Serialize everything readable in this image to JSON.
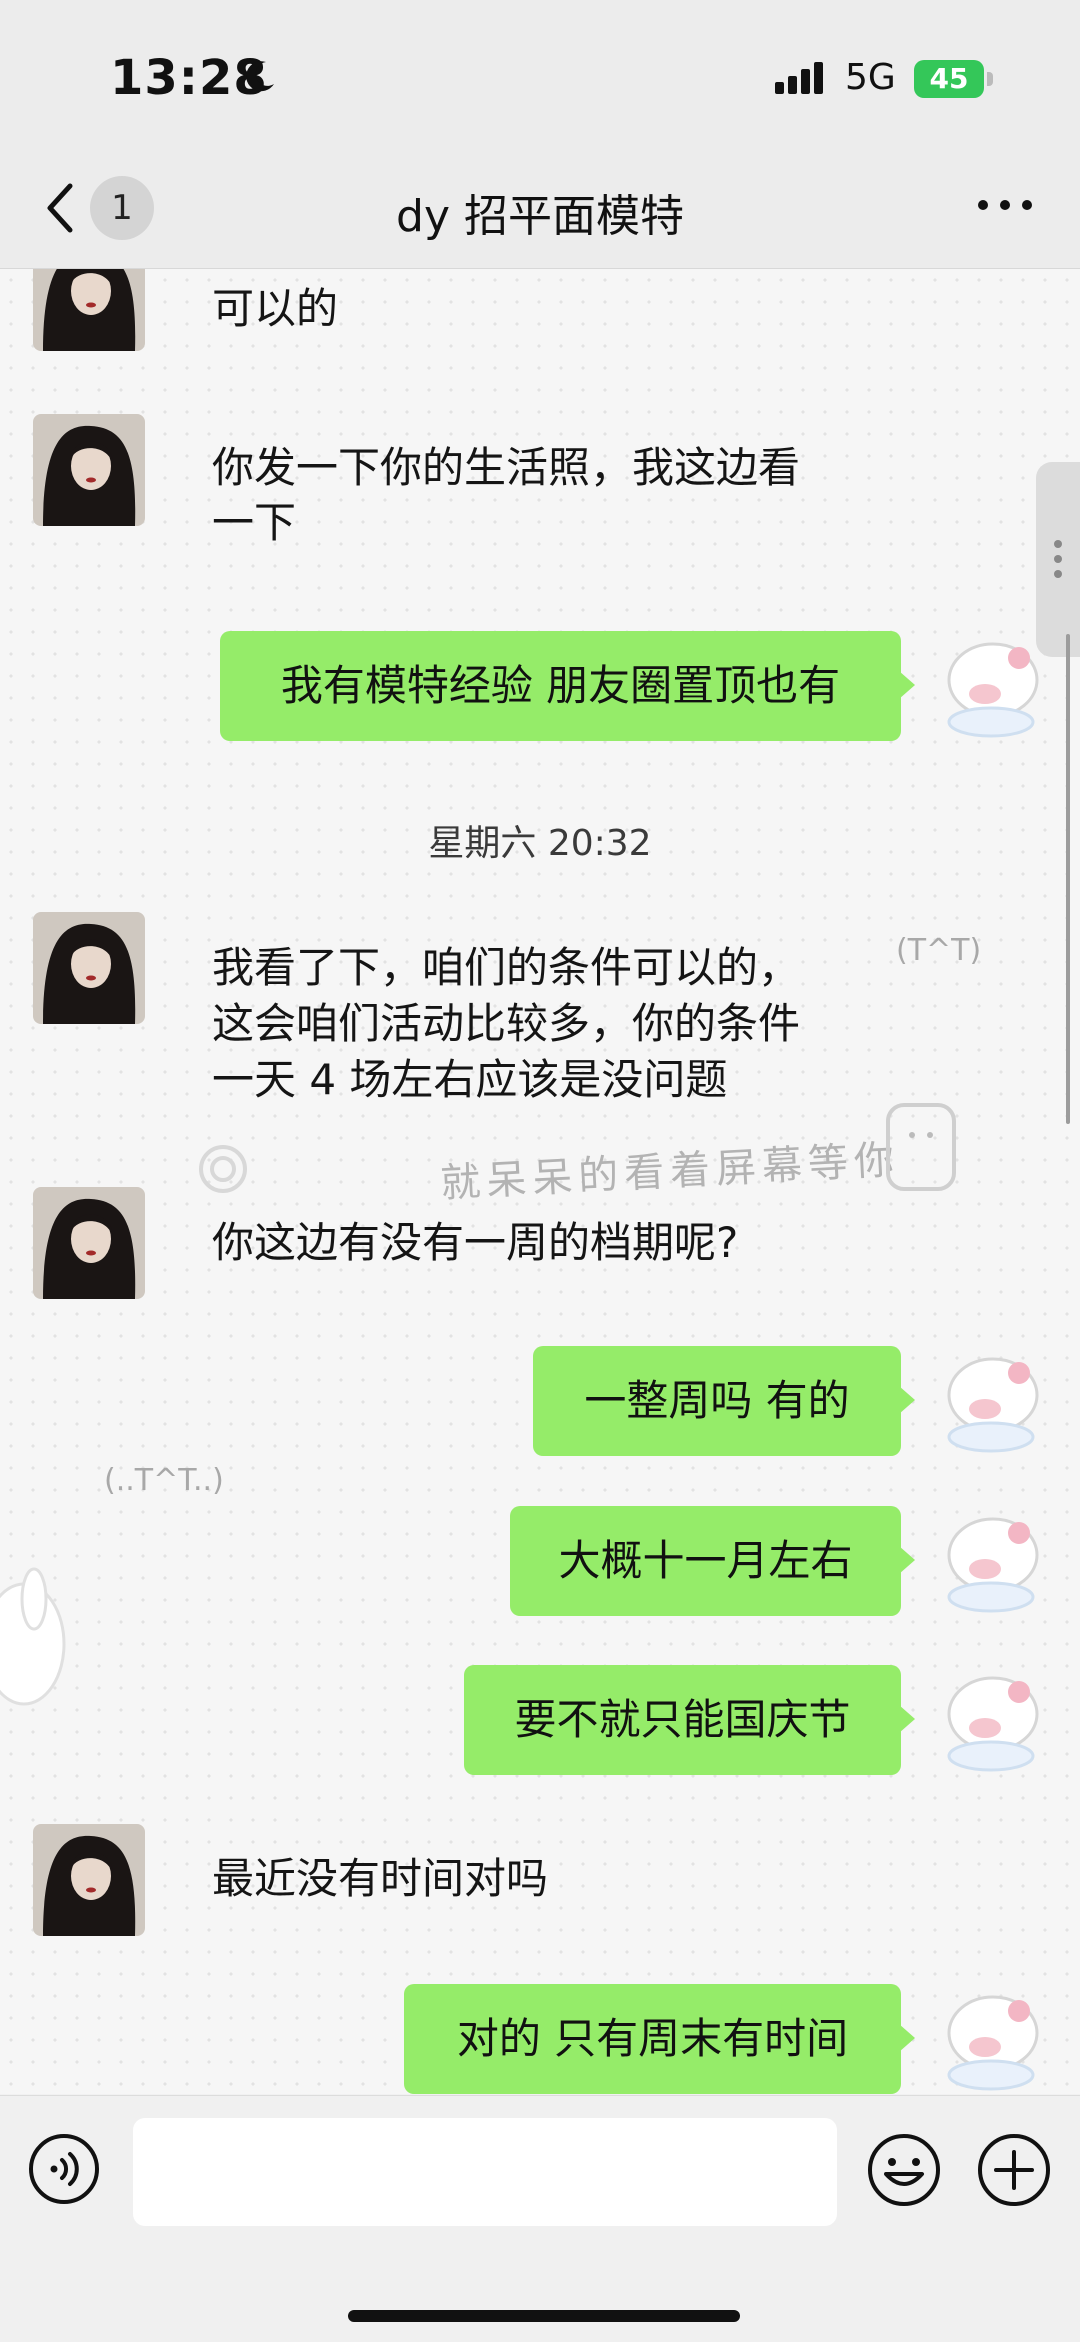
{
  "status": {
    "time": "13:28",
    "network": "5G",
    "battery": "45"
  },
  "nav": {
    "back_badge": "1",
    "title": "dy 招平面模特"
  },
  "messages": {
    "m1": "可以的",
    "m2a": "你发一下你的生活照，我这边看",
    "m2b": "一下",
    "m3": "我有模特经验 朋友圈置顶也有",
    "timestamp": "星期六 20:32",
    "m4a": "我看了下，咱们的条件可以的，",
    "m4b": "这会咱们活动比较多，你的条件",
    "m4c": "一天 4 场左右应该是没问题",
    "m5": "你这边有没有一周的档期呢?",
    "m6": "一整周吗 有的",
    "m7": "大概十一月左右",
    "m8": "要不就只能国庆节",
    "m9": "最近没有时间对吗",
    "m10": "对的 只有周末有时间"
  },
  "background_decor": {
    "handwriting": "就呆呆的看着屏幕等你",
    "kaomoji_1": "(T^T)",
    "kaomoji_2": "(..T^T..)"
  },
  "colors": {
    "outgoing_bubble": "#95ec69",
    "battery": "#34c759"
  }
}
